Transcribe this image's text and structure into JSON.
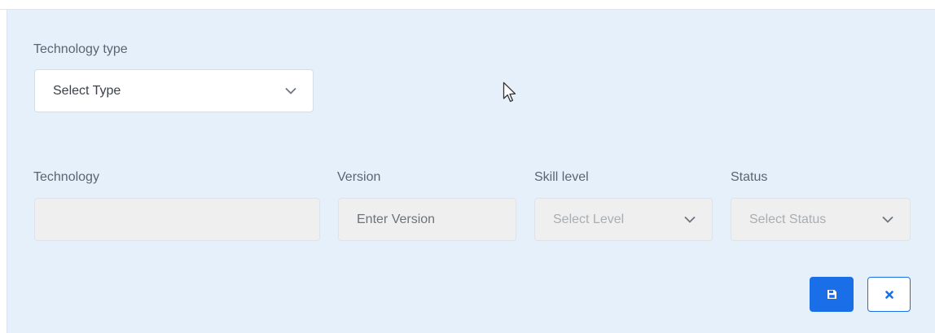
{
  "form": {
    "technology_type": {
      "label": "Technology type",
      "selected": "Select Type"
    },
    "technology": {
      "label": "Technology",
      "value": ""
    },
    "version": {
      "label": "Version",
      "placeholder": "Enter Version"
    },
    "skill_level": {
      "label": "Skill level",
      "selected": "Select Level"
    },
    "status": {
      "label": "Status",
      "selected": "Select Status"
    }
  },
  "actions": {
    "save_icon": "floppy-disk-icon",
    "close_icon": "close-icon"
  },
  "colors": {
    "panel_background": "#e6f0fa",
    "primary": "#1a6fe8",
    "input_disabled": "#efefef",
    "label_text": "#5b6470"
  }
}
